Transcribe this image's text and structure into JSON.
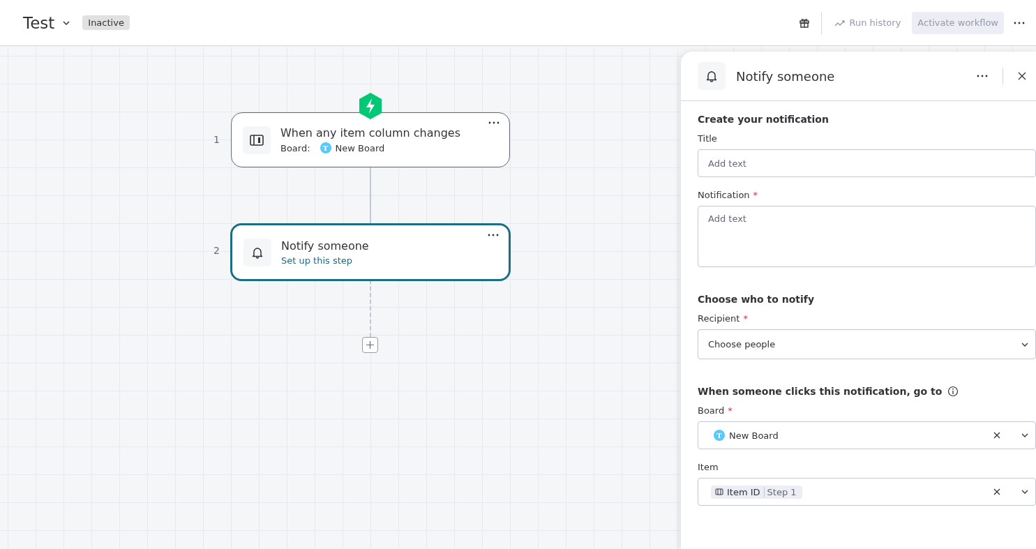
{
  "header": {
    "title": "Test",
    "status": "Inactive",
    "run_history": "Run history",
    "activate": {
      "label": "Activate workflow",
      "disabled": true
    }
  },
  "steps": [
    {
      "number": "1",
      "kind": "trigger",
      "title": "When any item column changes",
      "board_label": "Board:",
      "board_initial": "T",
      "board_name": "New Board",
      "selected": false
    },
    {
      "number": "2",
      "kind": "action",
      "title": "Notify someone",
      "link": "Set up this step",
      "selected": true
    }
  ],
  "panel": {
    "title": "Notify someone",
    "sections": [
      {
        "heading": "Create your notification",
        "info": false,
        "fields": [
          {
            "kind": "text",
            "label": "Title",
            "placeholder": "Add text"
          },
          {
            "kind": "textarea",
            "label": "Notification",
            "required_mark": "*",
            "placeholder": "Add text"
          }
        ]
      },
      {
        "heading": "Choose who to notify",
        "info": false,
        "fields": [
          {
            "kind": "select",
            "label": "Recipient",
            "required_mark": "*",
            "placeholder": "Choose people"
          }
        ]
      },
      {
        "heading": "When someone clicks this notification, go to",
        "info": true,
        "fields": [
          {
            "kind": "board",
            "label": "Board",
            "required_mark": "*",
            "initial": "T",
            "value": "New Board"
          },
          {
            "kind": "token",
            "label": "Item",
            "token": "Item ID",
            "source": "Step 1"
          }
        ]
      }
    ]
  }
}
